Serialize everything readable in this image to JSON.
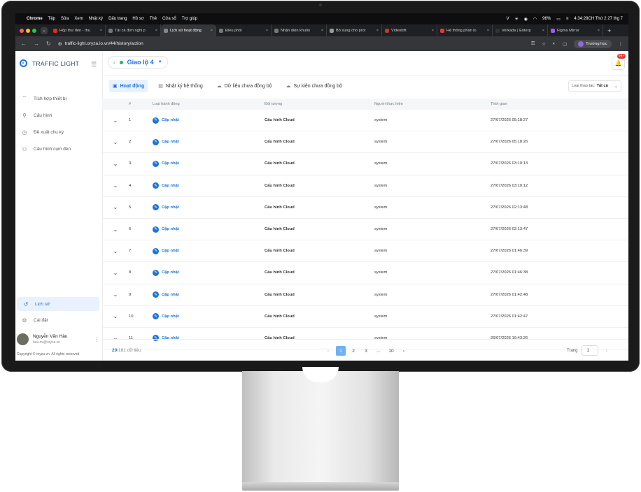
{
  "menubar": {
    "app": "Chrome",
    "items": [
      "Tệp",
      "Sửa",
      "Xem",
      "Nhật ký",
      "Dấu trang",
      "Hồ sơ",
      "Thẻ",
      "Cửa sổ",
      "Trợ giúp"
    ],
    "battery": "96%",
    "clock": "4:34:28CH Thứ 2 27 thg 7"
  },
  "browser": {
    "tabs": [
      {
        "title": "Hộp thư đến - thu",
        "color": "#d93025"
      },
      {
        "title": "Tất cả đơn nghỉ p",
        "color": "#777777"
      },
      {
        "title": "Lịch sử hoạt động",
        "color": "#888888",
        "active": true
      },
      {
        "title": "Điều phối",
        "color": "#777777"
      },
      {
        "title": "Nhận diện khuôn",
        "color": "#777777"
      },
      {
        "title": "Bổ sung cho prot",
        "color": "#999999"
      },
      {
        "title": "Videoloft",
        "color": "#c0392b"
      },
      {
        "title": "Hệ thống phần lo",
        "color": "#e53935"
      },
      {
        "title": "Verkada | Enterp",
        "color": "#333333"
      },
      {
        "title": "Figma Mirror",
        "color": "#a259ff"
      }
    ],
    "url": "traffic-light.oryza.io.vn/44/history/action",
    "profile": "Trường học"
  },
  "app": {
    "logo": "TRAFFIC LIGHT",
    "nav": [
      {
        "label": "Tích hợp thiết bị",
        "icon": "device-icon"
      },
      {
        "label": "Cấu hình",
        "icon": "config-icon"
      },
      {
        "label": "Đề xuất chu kỳ",
        "icon": "cycle-icon"
      },
      {
        "label": "Cấu hình cụm đèn",
        "icon": "light-cluster-icon"
      }
    ],
    "nav_bottom": [
      {
        "label": "Lịch sử",
        "icon": "history-icon",
        "active": true
      },
      {
        "label": "Cài đặt",
        "icon": "settings-icon"
      }
    ],
    "user": {
      "name": "Nguyễn Văn Hậu",
      "email": "hau.nv@oryza.vn"
    },
    "copyright": "Copyright © oryza.vn. All rights reserved",
    "intersection": "Giao lộ 4",
    "notifications": "99+",
    "page_tabs": [
      "Hoạt động",
      "Nhật ký hệ thống",
      "Dữ liệu chưa đồng bộ",
      "Sự kiện chưa đồng bộ"
    ],
    "filter": {
      "label": "Loại thao tác:",
      "value": "Tất cả"
    },
    "columns": [
      "#",
      "Loại hành động",
      "Đối tượng",
      "Người thực hiện",
      "Thời gian"
    ],
    "rows": [
      {
        "no": "1",
        "action": "Cập nhật",
        "object": "Cấu hình Cloud",
        "user": "system",
        "time": "27/07/2026 05:18:27"
      },
      {
        "no": "2",
        "action": "Cập nhật",
        "object": "Cấu hình Cloud",
        "user": "system",
        "time": "27/07/2026 05:18:26"
      },
      {
        "no": "3",
        "action": "Cập nhật",
        "object": "Cấu hình Cloud",
        "user": "system",
        "time": "27/07/2026 03:10:13"
      },
      {
        "no": "4",
        "action": "Cập nhật",
        "object": "Cấu hình Cloud",
        "user": "system",
        "time": "27/07/2026 03:10:12"
      },
      {
        "no": "5",
        "action": "Cập nhật",
        "object": "Cấu hình Cloud",
        "user": "system",
        "time": "27/07/2026 02:13:48"
      },
      {
        "no": "6",
        "action": "Cập nhật",
        "object": "Cấu hình Cloud",
        "user": "system",
        "time": "27/07/2026 02:13:47"
      },
      {
        "no": "7",
        "action": "Cập nhật",
        "object": "Cấu hình Cloud",
        "user": "system",
        "time": "27/07/2026 01:46:39"
      },
      {
        "no": "8",
        "action": "Cập nhật",
        "object": "Cấu hình Cloud",
        "user": "system",
        "time": "27/07/2026 01:46:38"
      },
      {
        "no": "9",
        "action": "Cập nhật",
        "object": "Cấu hình Cloud",
        "user": "system",
        "time": "27/07/2026 01:42:48"
      },
      {
        "no": "10",
        "action": "Cập nhật",
        "object": "Cấu hình Cloud",
        "user": "system",
        "time": "27/07/2026 01:42:47"
      },
      {
        "no": "11",
        "action": "Cập nhật",
        "object": "Cấu hình Cloud",
        "user": "system",
        "time": "26/07/2026 19:43:26"
      }
    ],
    "footer": {
      "shown": "20",
      "total": "/181",
      "unit": "dữ liệu",
      "pages": [
        "1",
        "2",
        "3",
        "...",
        "10"
      ],
      "current": "1",
      "goto_label": "Trang",
      "goto_value": "1"
    }
  }
}
